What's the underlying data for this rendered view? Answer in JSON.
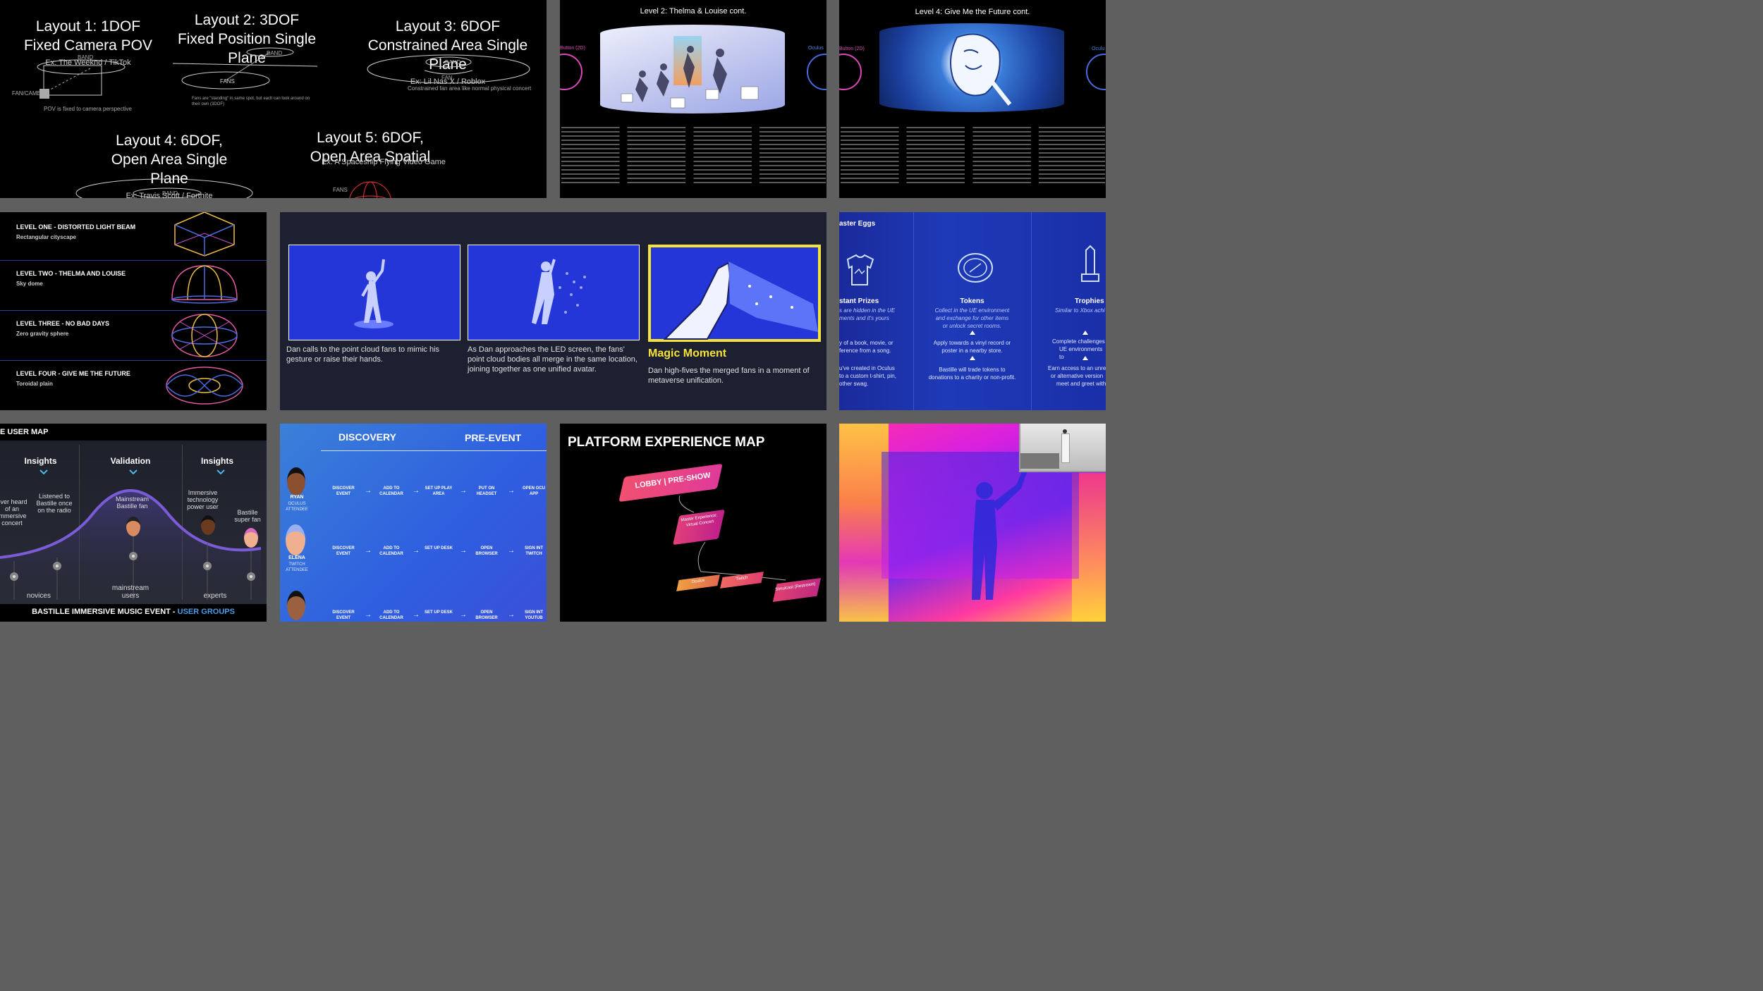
{
  "layouts": {
    "l1": {
      "title": "Layout 1: 1DOF",
      "subtitle": "Fixed Camera POV",
      "example": "Ex: The Weeknd / TikTok",
      "band": "BAND",
      "fan": "FAN/CAMERA",
      "note": "POV is fixed to camera perspective"
    },
    "l2": {
      "title": "Layout 2: 3DOF",
      "subtitle": "Fixed Position Single Plane",
      "band": "BAND",
      "fans": "FANS",
      "note": "Fans are \"standing\" in same spot, but each can look around on their own (3DOF)"
    },
    "l3": {
      "title": "Layout 3: 6DOF",
      "subtitle": "Constrained Area Single Plane",
      "example": "Ex: Lil Nas X / Roblox",
      "band": "BAND",
      "fan": "FAN",
      "note": "Constrained fan area like normal physical concert"
    },
    "l4": {
      "title": "Layout 4: 6DOF,",
      "subtitle": "Open Area Single Plane",
      "example": "Ex: Travis Scott / Fortnite",
      "band": "BAND"
    },
    "l5": {
      "title": "Layout 5: 6DOF,",
      "subtitle": "Open Area Spatial",
      "example": "Ex: A Spaceship Flying Video Game",
      "fans": "FANS"
    }
  },
  "level2": {
    "title": "Level 2: Thelma & Louise cont.",
    "left_label": "Button (2D)",
    "right_label": "Oculus"
  },
  "level4": {
    "title": "Level 4: Give Me the Future cont.",
    "left_label": "Button (2D)",
    "right_label": "Oculu"
  },
  "levels": [
    {
      "name": "LEVEL ONE - DISTORTED LIGHT BEAM",
      "desc": "Rectangular cityscape",
      "icon": "cube-wireframe-icon"
    },
    {
      "name": "LEVEL TWO - THELMA AND LOUISE",
      "desc": "Sky dome",
      "icon": "dome-wireframe-icon"
    },
    {
      "name": "LEVEL THREE - NO BAD DAYS",
      "desc": "Zero gravity sphere",
      "icon": "sphere-wireframe-icon"
    },
    {
      "name": "LEVEL FOUR - GIVE ME THE FUTURE",
      "desc": "Toroidal plain",
      "icon": "torus-wireframe-icon"
    }
  ],
  "story": {
    "panel1": "Dan calls to the point cloud fans to mimic his gesture or raise their hands.",
    "panel2": "As Dan approaches the LED screen, the fans' point cloud bodies all merge in the same location, joining together as one unified avatar.",
    "panel3_title": "Magic Moment",
    "panel3": "Dan high-fives the merged fans in a moment of metaverse unification.",
    "accent": "#f5e23a"
  },
  "easter": {
    "title": "aster Eggs",
    "cols": [
      {
        "title": "stant Prizes",
        "lines": [
          "s are hidden in the UE",
          "ments and it's yours"
        ],
        "lines2": [
          "y of a book, movie, or",
          "ference from a song."
        ],
        "lines3": [
          "u've created in Oculus",
          "to a custom t-shirt, pin,",
          "other swag."
        ]
      },
      {
        "title": "Tokens",
        "lines": [
          "Collect in the UE environment",
          "and exchange for other items",
          "or unlock secret rooms."
        ],
        "lines2": [
          "Apply towards a vinyl record or",
          "poster in a nearby store."
        ],
        "lines3": [
          "Bastille will trade tokens to",
          "donations to a charity or non-profit."
        ]
      },
      {
        "title": "Trophies",
        "lines": [
          "Similar to Xbox achi"
        ],
        "lines2": [
          "Complete challenges",
          "UE environments to"
        ],
        "lines3": [
          "Earn access to an unrel",
          "or alternative version",
          "meet and greet with"
        ]
      }
    ]
  },
  "usermap": {
    "title": "E USER MAP",
    "phases": [
      "Insights",
      "Validation",
      "Insights"
    ],
    "labels": [
      "ever heard of an immersive concert",
      "Listened to Bastille once on the radio",
      "Mainstream Bastille fan",
      "Immersive technology power user",
      "Bastille super fan"
    ],
    "axis": [
      "novices",
      "mainstream users",
      "experts"
    ],
    "footer_main": "BASTILLE IMMERSIVE MUSIC EVENT - ",
    "footer_accent": "USER GROUPS",
    "accent": "#4a9be8"
  },
  "journey": {
    "stage1": "DISCOVERY",
    "stage2": "PRE-EVENT",
    "people": [
      {
        "name": "RYAN",
        "role": "OCULUS ATTENDEE",
        "steps": [
          "DISCOVER EVENT",
          "ADD TO CALENDAR",
          "SET UP PLAY AREA",
          "PUT ON HEADSET",
          "OPEN OCU APP"
        ]
      },
      {
        "name": "ELENA",
        "role": "TWITCH ATTENDEE",
        "steps": [
          "DISCOVER EVENT",
          "ADD TO CALENDAR",
          "SET UP DESK",
          "OPEN BROWSER",
          "SIGN INT TWITCH"
        ]
      },
      {
        "name": "",
        "role": "",
        "steps": [
          "DISCOVER EVENT",
          "ADD TO CALENDAR",
          "SET UP DESK",
          "OPEN BROWSER",
          "SIGN INT YOUTUB"
        ]
      }
    ]
  },
  "platform": {
    "title": "PLATFORM EXPERIENCE MAP",
    "lobby": "LOBBY | PRE-SHOW",
    "master": "Master Experience: Virtual Concert",
    "nodes": [
      "Oculus",
      "Twitch",
      "Simulcast (Restream)"
    ]
  },
  "colors": {
    "purple": "#7a5cd6",
    "blue_tile": "#2b3fe0",
    "pink": "#ff2fa8"
  }
}
